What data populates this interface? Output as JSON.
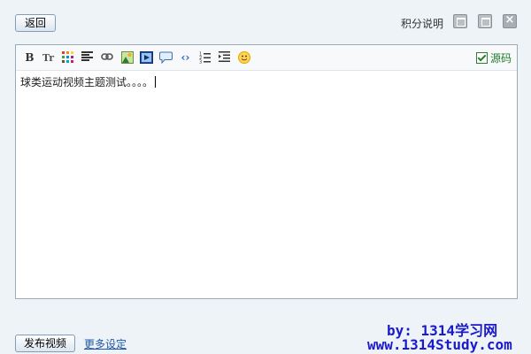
{
  "header": {
    "back_label": "返回",
    "points_label": "积分说明"
  },
  "editor": {
    "toolbar": {
      "source_label": "源码",
      "source_checked": true,
      "buttons": [
        {
          "name": "bold-icon",
          "glyph": "B"
        },
        {
          "name": "font-size-icon",
          "glyph": "Tт"
        },
        {
          "name": "color-palette-icon",
          "glyph": ""
        },
        {
          "name": "align-icon",
          "glyph": ""
        },
        {
          "name": "link-icon",
          "glyph": ""
        },
        {
          "name": "image-icon",
          "glyph": ""
        },
        {
          "name": "video-icon",
          "glyph": ""
        },
        {
          "name": "quote-icon",
          "glyph": ""
        },
        {
          "name": "code-icon",
          "glyph": "‹›"
        },
        {
          "name": "ordered-list-icon",
          "glyph": ""
        },
        {
          "name": "indent-icon",
          "glyph": ""
        },
        {
          "name": "emoticon-icon",
          "glyph": ""
        }
      ]
    },
    "content_text": "球类运动视频主题测试。。。。"
  },
  "footer": {
    "publish_label": "发布视频",
    "more_settings_label": "更多设定"
  },
  "watermark": {
    "line1": "by: 1314学习网",
    "line2": "www.1314Study.com"
  },
  "colors": {
    "background": "#eef3f8",
    "link": "#1f57a8",
    "watermark": "#1a1acc",
    "source_green": "#1f7b2b"
  }
}
